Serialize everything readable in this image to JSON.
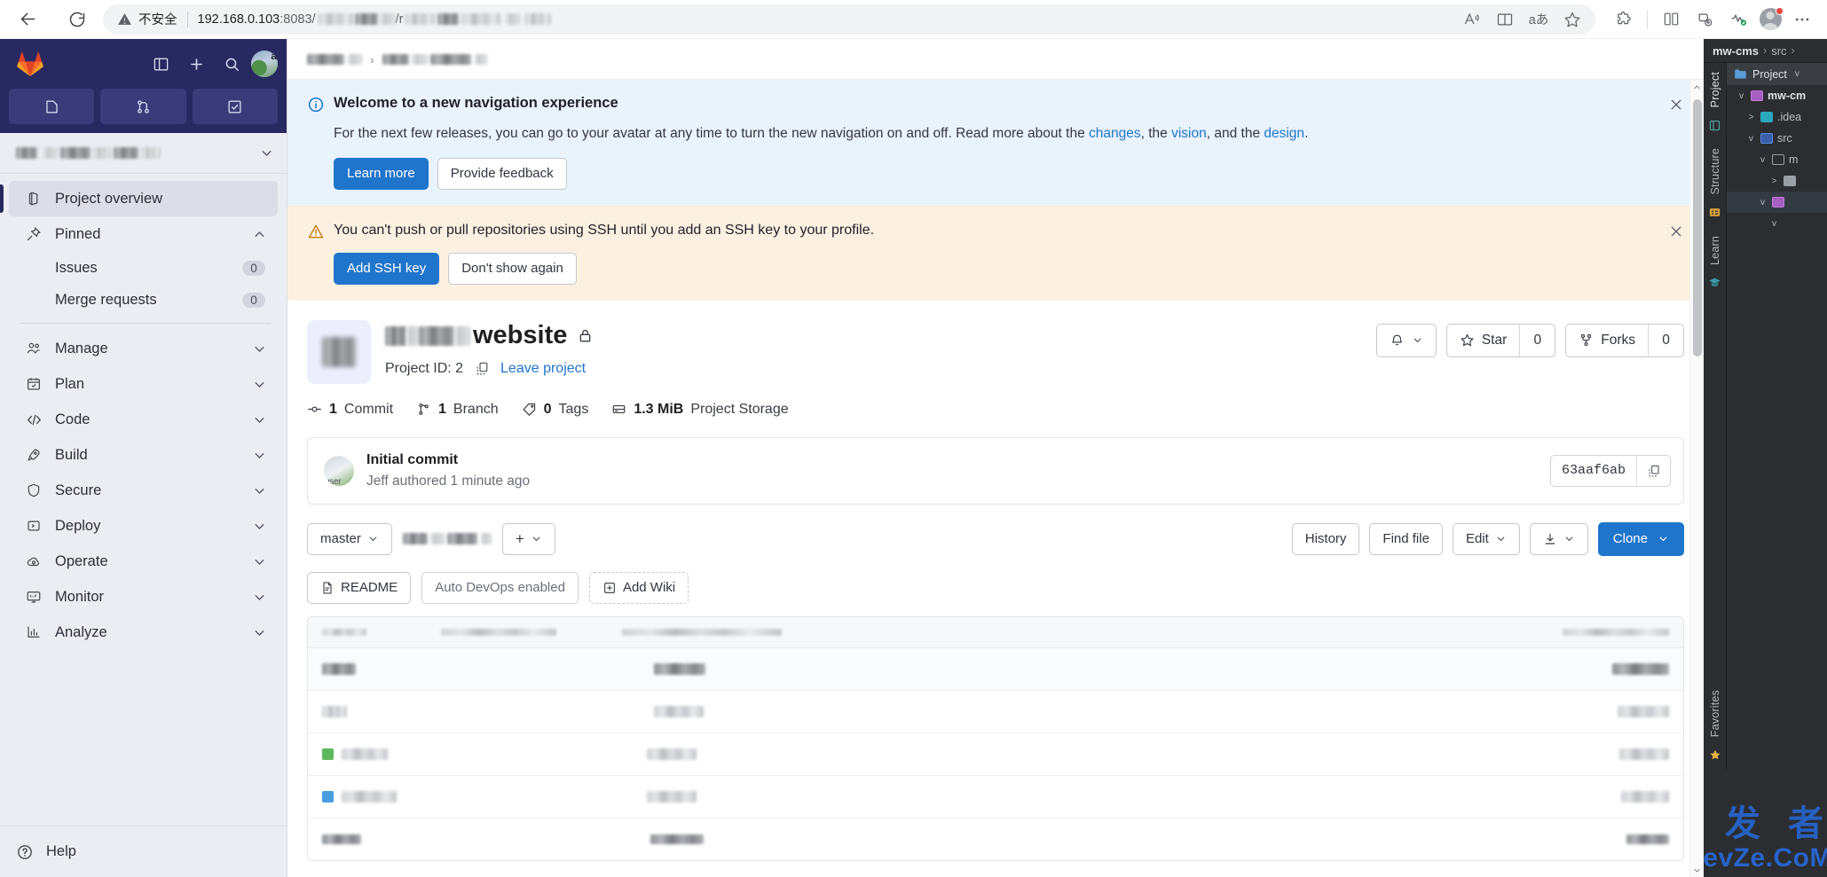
{
  "browser": {
    "back_icon": "back-arrow-icon",
    "reload_icon": "reload-icon",
    "security_label": "不安全",
    "url_host": "192.168.0.103",
    "url_port": ":8083",
    "url_path_sep": "/",
    "url_tail": "/r",
    "toolbar_icons": [
      "read-aloud-icon",
      "immersive-reader-icon",
      "translate-icon",
      "favorite-star-icon",
      "extensions-icon",
      "split-screen-icon",
      "collections-icon",
      "browser-essentials-icon",
      "profile-avatar-icon",
      "settings-more-icon"
    ],
    "translate_glyph": "aあ",
    "read_aloud_glyph": "A"
  },
  "sidebar": {
    "logo": "gitlab-logo-icon",
    "top_actions": [
      "toggle-sidebar-icon",
      "create-new-icon",
      "search-icon",
      "user-avatar"
    ],
    "avatar_letter": "a",
    "quick_tabs": [
      "issues-tab-icon",
      "merge-requests-tab-icon",
      "todos-tab-icon"
    ],
    "project_switcher_label": "",
    "overview_label": "Project overview",
    "pinned_label": "Pinned",
    "pinned_items": [
      {
        "label": "Issues",
        "count": "0"
      },
      {
        "label": "Merge requests",
        "count": "0"
      }
    ],
    "sections": [
      {
        "label": "Manage",
        "icon": "users-icon"
      },
      {
        "label": "Plan",
        "icon": "calendar-icon"
      },
      {
        "label": "Code",
        "icon": "code-brackets-icon"
      },
      {
        "label": "Build",
        "icon": "rocket-icon"
      },
      {
        "label": "Secure",
        "icon": "shield-icon"
      },
      {
        "label": "Deploy",
        "icon": "deploy-icon"
      },
      {
        "label": "Operate",
        "icon": "cloud-gear-icon"
      },
      {
        "label": "Monitor",
        "icon": "monitor-icon"
      },
      {
        "label": "Analyze",
        "icon": "chart-icon"
      }
    ],
    "help_label": "Help"
  },
  "alerts": {
    "info": {
      "title": "Welcome to a new navigation experience",
      "text_1": "For the next few releases, you can go to your avatar at any time to turn the new navigation on and off. Read more about the ",
      "link_1": "changes",
      "text_2": ", the ",
      "link_2": "vision",
      "text_3": ", and the ",
      "link_3": "design",
      "text_4": ".",
      "primary_button": "Learn more",
      "secondary_button": "Provide feedback",
      "close_label": "×"
    },
    "warning": {
      "text": "You can't push or pull repositories using SSH until you add an SSH key to your profile.",
      "primary_button": "Add SSH key",
      "secondary_button": "Don't show again",
      "close_label": "×"
    }
  },
  "project": {
    "name_suffix": "website",
    "visibility_icon": "lock-icon",
    "project_id_label": "Project ID: 2",
    "copy_id_icon": "copy-icon",
    "leave_link": "Leave project",
    "notification_icon": "bell-icon",
    "star_label": "Star",
    "star_count": "0",
    "forks_label": "Forks",
    "forks_count": "0",
    "stats": [
      {
        "icon": "commit-icon",
        "value": "1",
        "label": "Commit"
      },
      {
        "icon": "branch-icon",
        "value": "1",
        "label": "Branch"
      },
      {
        "icon": "tag-icon",
        "value": "0",
        "label": "Tags"
      },
      {
        "icon": "storage-icon",
        "value": "1.3 MiB",
        "label": "Project Storage"
      }
    ]
  },
  "commit": {
    "title": "Initial commit",
    "meta": "Jeff authored 1 minute ago",
    "avatar_caption": "user",
    "sha": "63aaf6ab",
    "copy_icon": "copy-icon"
  },
  "repo_toolbar": {
    "branch": "master",
    "add_label": "+",
    "history": "History",
    "find_file": "Find file",
    "edit": "Edit",
    "download_icon": "download-icon",
    "clone": "Clone"
  },
  "tags": {
    "readme": "README",
    "auto_devops": "Auto DevOps enabled",
    "add_wiki": "Add Wiki",
    "readme_icon": "document-icon",
    "wiki_icon": "plus-square-icon"
  },
  "ide": {
    "breadcrumb": [
      "mw-cms",
      "src"
    ],
    "breadcrumb_sep": "›",
    "tool_tabs": [
      "Project",
      "Structure",
      "Learn",
      "Favorites"
    ],
    "panel_title": "Project",
    "tree": [
      {
        "name": "mw-cm",
        "depth": 0,
        "chev": "v",
        "color": "#c678dd",
        "bold": true
      },
      {
        "name": ".idea",
        "depth": 1,
        "chev": ">",
        "color": "#3bb0c9",
        "bold": false
      },
      {
        "name": "src",
        "depth": 1,
        "chev": "v",
        "color": "#5b8ae8",
        "bold": false
      },
      {
        "name": "m",
        "depth": 2,
        "chev": "v",
        "color": "#9aa0a6",
        "bold": false
      },
      {
        "name": "",
        "depth": 3,
        "chev": ">",
        "color": "#9aa0a6",
        "bold": false
      },
      {
        "name": "",
        "depth": 2,
        "chev": "v",
        "color": "#c678dd",
        "bold": false
      }
    ],
    "watermark_cn": "开 发 者",
    "watermark_en": "DevZe.CoM"
  }
}
